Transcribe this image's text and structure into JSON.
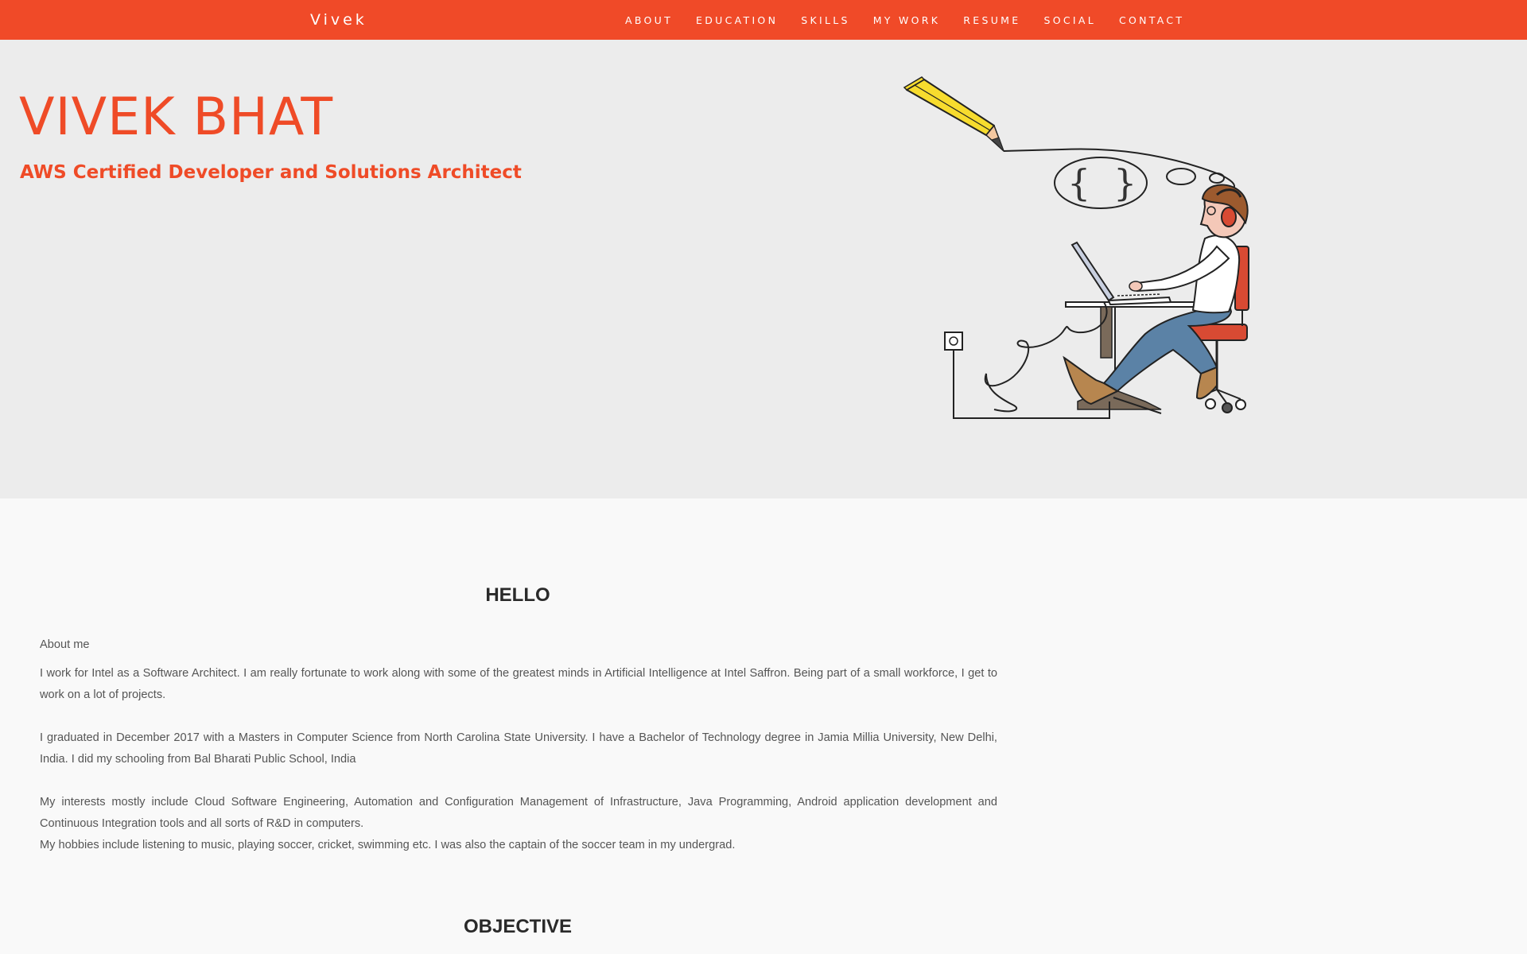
{
  "nav": {
    "brand": "Vivek",
    "links": [
      "ABOUT",
      "EDUCATION",
      "SKILLS",
      "MY WORK",
      "RESUME",
      "SOCIAL",
      "CONTACT"
    ]
  },
  "hero": {
    "name": "VIVEK BHAT",
    "title": "AWS Certified Developer and Solutions Architect"
  },
  "about": {
    "heading": "HELLO",
    "label": "About me",
    "paragraphs": [
      "I work for Intel as a Software Architect. I am really fortunate to work along with some of the greatest minds in Artificial Intelligence at Intel Saffron. Being part of a small workforce, I get to work on a lot of projects.",
      "I graduated in December 2017 with a Masters in Computer Science from North Carolina State University. I have a Bachelor of Technology degree in Jamia Millia University, New Delhi, India. I did my schooling from Bal Bharati Public School, India",
      "My interests mostly include Cloud Software Engineering, Automation and Configuration Management of Infrastructure, Java Programming, Android application development and Continuous Integration tools and all sorts of R&D in computers.",
      "My hobbies include listening to music, playing soccer, cricket, swimming etc. I was also the captain of the soccer team in my undergrad."
    ]
  },
  "objective": {
    "heading": "OBJECTIVE"
  },
  "colors": {
    "accent": "#f04a28",
    "hero_bg": "#ececec",
    "page_bg": "#f9f9f9",
    "heading": "#2a2a2a",
    "body_text": "#555555"
  },
  "icons": {
    "hero_illustration": "developer-at-laptop-illustration"
  }
}
